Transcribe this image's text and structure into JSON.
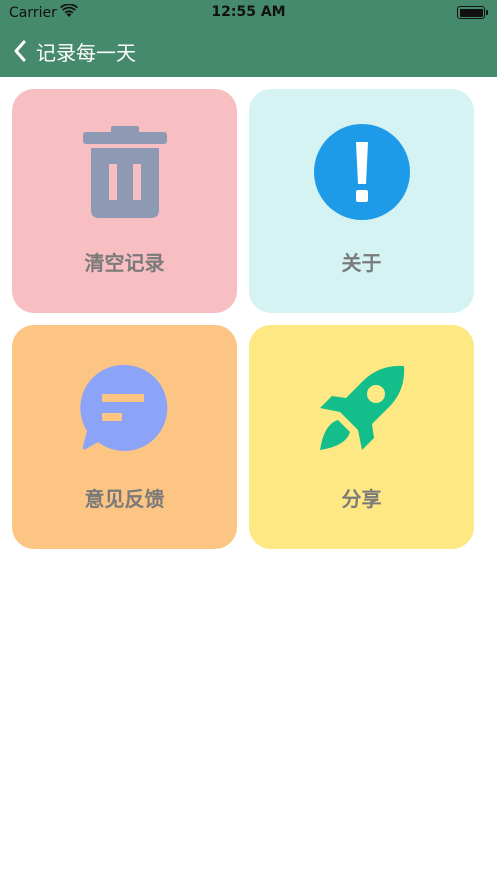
{
  "status_bar": {
    "carrier": "Carrier",
    "time": "12:55 AM"
  },
  "nav": {
    "title": "记录每一天"
  },
  "tiles": [
    {
      "label": "清空记录",
      "icon": "trash-icon",
      "bg": "#f7bfc2",
      "icon_color": "#8e9ab4"
    },
    {
      "label": "关于",
      "icon": "info-exclamation-icon",
      "bg": "#d6f3f4",
      "icon_color": "#1e9be8"
    },
    {
      "label": "意见反馈",
      "icon": "chat-bubble-icon",
      "bg": "#fdc584",
      "icon_color": "#8ca4f7"
    },
    {
      "label": "分享",
      "icon": "rocket-icon",
      "bg": "#fee883",
      "icon_color": "#13be8a"
    }
  ],
  "colors": {
    "header": "#468a6e",
    "label_text": "#7a7a7a"
  }
}
